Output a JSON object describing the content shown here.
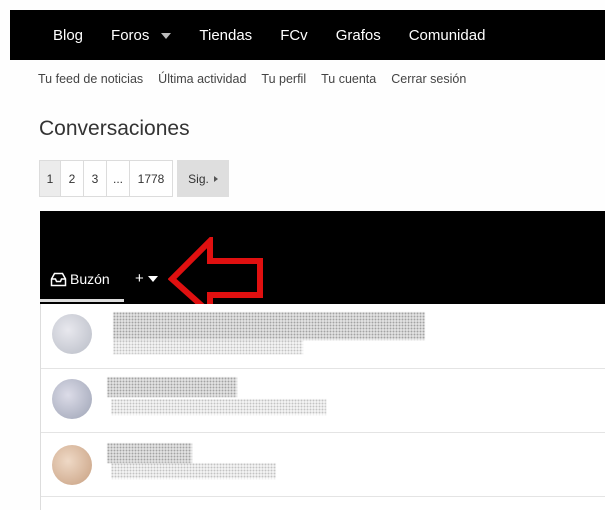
{
  "topnav": {
    "items": [
      "Blog",
      "Foros",
      "Tiendas",
      "FCv",
      "Grafos",
      "Comunidad"
    ]
  },
  "subnav": {
    "items": [
      "Tu feed de noticias",
      "Última actividad",
      "Tu perfil",
      "Tu cuenta",
      "Cerrar sesión"
    ]
  },
  "page": {
    "title": "Conversaciones"
  },
  "pagination": {
    "pages": [
      "1",
      "2",
      "3",
      "...",
      "1778"
    ],
    "current": "1",
    "next_label": "Sig."
  },
  "tabs": {
    "inbox_label": "Buzón",
    "new_label": "+"
  },
  "colors": {
    "annotation_arrow": "#e01010",
    "header_bg": "#000000"
  }
}
